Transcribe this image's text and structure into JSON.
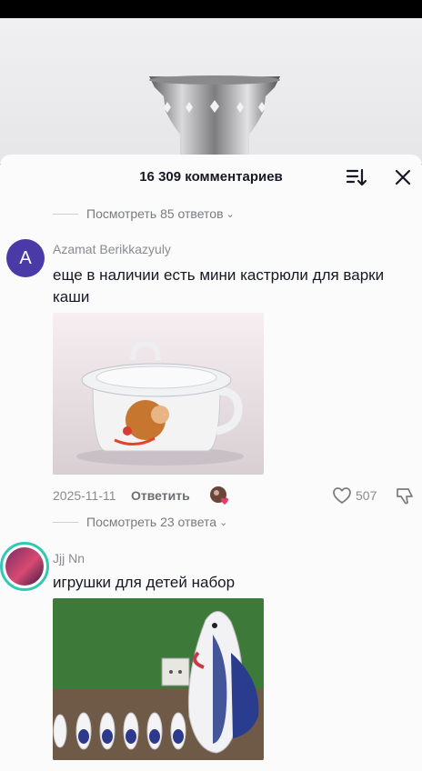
{
  "comments_panel": {
    "title": "16 309 комментариев",
    "sort_icon": "sort-icon",
    "close_icon": "close-icon"
  },
  "top_replies": {
    "label": "Посмотреть 85 ответов"
  },
  "comments": [
    {
      "avatar_letter": "A",
      "username": "Azamat Berikkazyuly",
      "text": "еще в наличии есть мини кастрюли для варки каши",
      "date": "2025-11-11",
      "reply_label": "Ответить",
      "likes": "507",
      "replies_label": "Посмотреть 23 ответа"
    },
    {
      "username": "Jjj Nn",
      "text": "игрушки для детей набор"
    }
  ],
  "colors": {
    "accent_avatar": "#4a3aa8",
    "ring": "#30c9b6",
    "like_pink": "#ea3a6a"
  }
}
